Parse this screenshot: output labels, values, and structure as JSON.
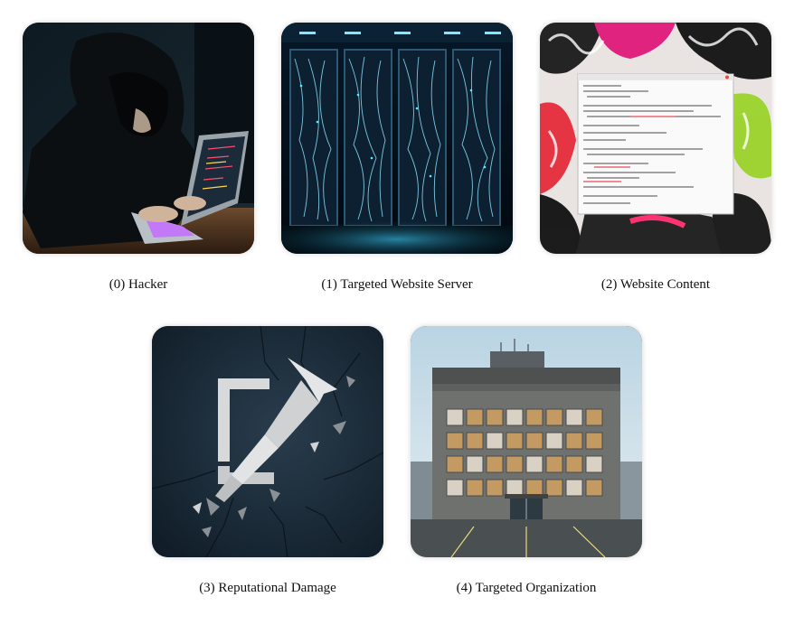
{
  "panels": [
    {
      "label": "(0) Hacker",
      "image": "hooded-hacker-at-laptop"
    },
    {
      "label": "(1) Targeted Website Server",
      "image": "server-racks-with-cables"
    },
    {
      "label": "(2) Website Content",
      "image": "graffiti-with-code-window"
    },
    {
      "label": "(3) Reputational Damage",
      "image": "cracked-wall-broken-arrow"
    },
    {
      "label": "(4) Targeted Organization",
      "image": "abandoned-office-building"
    }
  ]
}
